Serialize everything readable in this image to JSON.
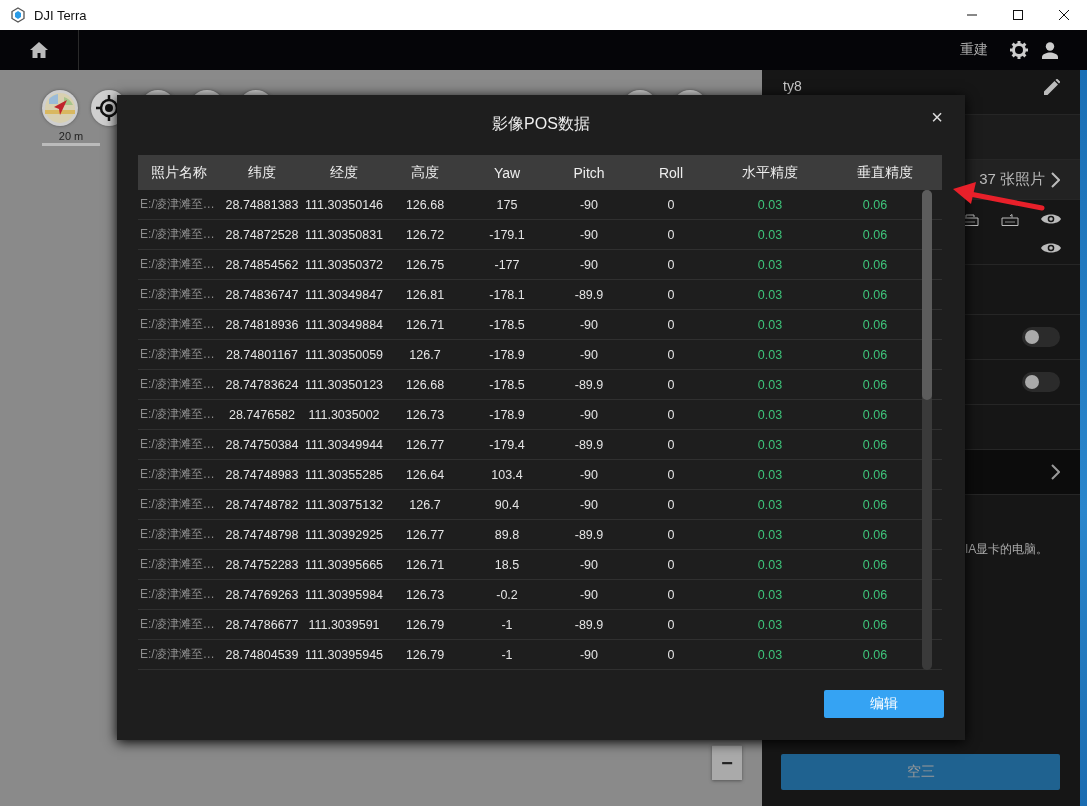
{
  "window": {
    "title": "DJI Terra"
  },
  "topbar": {
    "rebuild_label": "重建"
  },
  "map": {
    "scale_label": "20 m",
    "zoom_out_label": "−"
  },
  "side_panel": {
    "mission_name": "ty8",
    "photo_count": "37 张照片",
    "toggles": [
      {
        "on": false
      },
      {
        "on": false
      }
    ],
    "note": "IA显卡的电脑。",
    "action_button": "空三"
  },
  "dialog": {
    "title": "影像POS数据",
    "close_label": "×",
    "edit_button": "编辑",
    "columns": [
      {
        "label": "照片名称",
        "kind": "name"
      },
      {
        "label": "纬度",
        "kind": "value"
      },
      {
        "label": "经度",
        "kind": "value"
      },
      {
        "label": "高度",
        "kind": "value"
      },
      {
        "label": "Yaw",
        "kind": "value"
      },
      {
        "label": "Pitch",
        "kind": "value"
      },
      {
        "label": "Roll",
        "kind": "value"
      },
      {
        "label": "水平精度",
        "kind": "accuracy"
      },
      {
        "label": "垂直精度",
        "kind": "accuracy"
      }
    ],
    "rows": [
      [
        "E:/凌津滩至…",
        "28.74881383",
        "111.30350146",
        "126.68",
        "175",
        "-90",
        "0",
        "0.03",
        "0.06"
      ],
      [
        "E:/凌津滩至…",
        "28.74872528",
        "111.30350831",
        "126.72",
        "-179.1",
        "-90",
        "0",
        "0.03",
        "0.06"
      ],
      [
        "E:/凌津滩至…",
        "28.74854562",
        "111.30350372",
        "126.75",
        "-177",
        "-90",
        "0",
        "0.03",
        "0.06"
      ],
      [
        "E:/凌津滩至…",
        "28.74836747",
        "111.30349847",
        "126.81",
        "-178.1",
        "-89.9",
        "0",
        "0.03",
        "0.06"
      ],
      [
        "E:/凌津滩至…",
        "28.74818936",
        "111.30349884",
        "126.71",
        "-178.5",
        "-90",
        "0",
        "0.03",
        "0.06"
      ],
      [
        "E:/凌津滩至…",
        "28.74801167",
        "111.30350059",
        "126.7",
        "-178.9",
        "-90",
        "0",
        "0.03",
        "0.06"
      ],
      [
        "E:/凌津滩至…",
        "28.74783624",
        "111.30350123",
        "126.68",
        "-178.5",
        "-89.9",
        "0",
        "0.03",
        "0.06"
      ],
      [
        "E:/凌津滩至…",
        "28.7476582",
        "111.3035002",
        "126.73",
        "-178.9",
        "-90",
        "0",
        "0.03",
        "0.06"
      ],
      [
        "E:/凌津滩至…",
        "28.74750384",
        "111.30349944",
        "126.77",
        "-179.4",
        "-89.9",
        "0",
        "0.03",
        "0.06"
      ],
      [
        "E:/凌津滩至…",
        "28.74748983",
        "111.30355285",
        "126.64",
        "103.4",
        "-90",
        "0",
        "0.03",
        "0.06"
      ],
      [
        "E:/凌津滩至…",
        "28.74748782",
        "111.30375132",
        "126.7",
        "90.4",
        "-90",
        "0",
        "0.03",
        "0.06"
      ],
      [
        "E:/凌津滩至…",
        "28.74748798",
        "111.30392925",
        "126.77",
        "89.8",
        "-89.9",
        "0",
        "0.03",
        "0.06"
      ],
      [
        "E:/凌津滩至…",
        "28.74752283",
        "111.30395665",
        "126.71",
        "18.5",
        "-90",
        "0",
        "0.03",
        "0.06"
      ],
      [
        "E:/凌津滩至…",
        "28.74769263",
        "111.30395984",
        "126.73",
        "-0.2",
        "-90",
        "0",
        "0.03",
        "0.06"
      ],
      [
        "E:/凌津滩至…",
        "28.74786677",
        "111.3039591",
        "126.79",
        "-1",
        "-89.9",
        "0",
        "0.03",
        "0.06"
      ],
      [
        "E:/凌津滩至…",
        "28.74804539",
        "111.30395945",
        "126.79",
        "-1",
        "-90",
        "0",
        "0.03",
        "0.06"
      ]
    ]
  }
}
